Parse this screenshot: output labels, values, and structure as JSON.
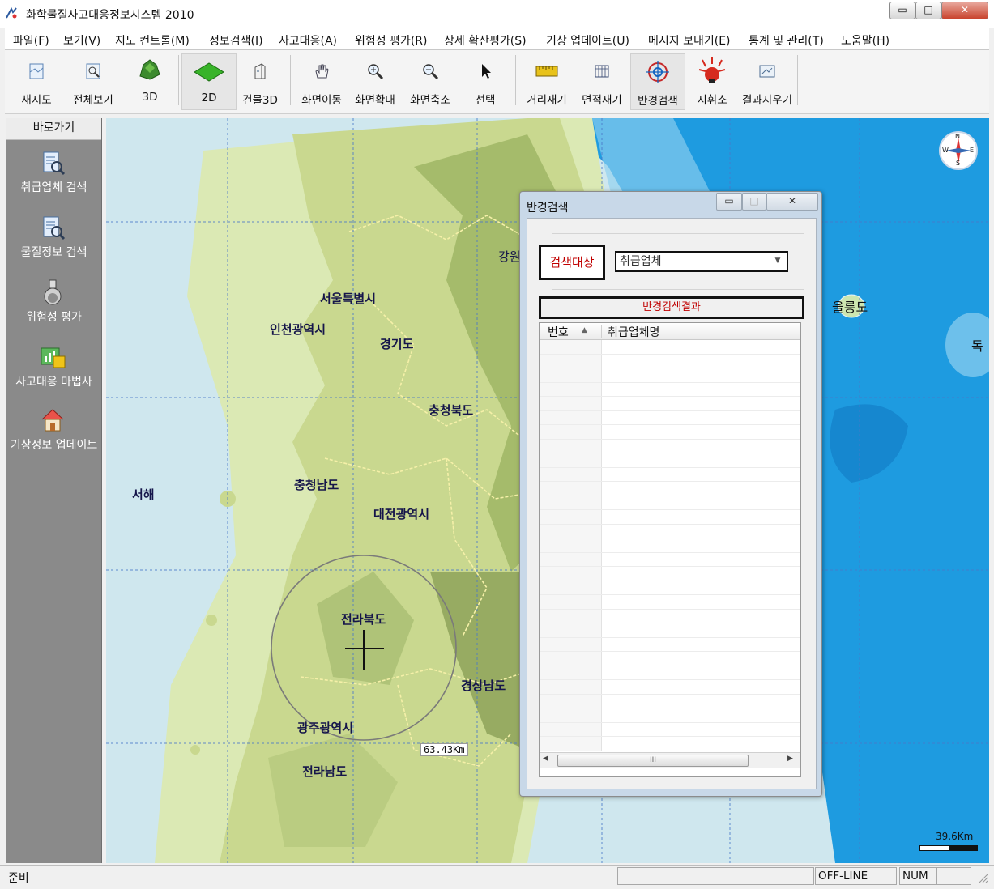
{
  "window": {
    "title": "화학물질사고대응정보시스템 2010",
    "controls": {
      "minimize": "▭",
      "maximize": "□",
      "close": "✕"
    }
  },
  "menu": [
    "파일(F)",
    "보기(V)",
    "지도 컨트롤(M)",
    "정보검색(I)",
    "사고대응(A)",
    "위험성 평가(R)",
    "상세 확산평가(S)",
    "기상 업데이트(U)",
    "메시지 보내기(E)",
    "통계 및 관리(T)",
    "도움말(H)"
  ],
  "toolbar": [
    {
      "label": "새지도",
      "icon": "new-map-icon"
    },
    {
      "label": "전체보기",
      "icon": "full-view-icon"
    },
    {
      "label": "3D",
      "icon": "3d-terrain-icon"
    },
    {
      "label": "2D",
      "icon": "2d-map-icon",
      "active": true
    },
    {
      "label": "건물3D",
      "icon": "building-3d-icon"
    },
    {
      "label": "화면이동",
      "icon": "pan-hand-icon"
    },
    {
      "label": "화면확대",
      "icon": "zoom-in-icon"
    },
    {
      "label": "화면축소",
      "icon": "zoom-out-icon"
    },
    {
      "label": "선택",
      "icon": "select-arrow-icon"
    },
    {
      "label": "거리재기",
      "icon": "ruler-icon"
    },
    {
      "label": "면적재기",
      "icon": "area-measure-icon"
    },
    {
      "label": "반경검색",
      "icon": "radius-target-icon",
      "active": true
    },
    {
      "label": "지휘소",
      "icon": "command-post-icon"
    },
    {
      "label": "결과지우기",
      "icon": "clear-result-icon"
    }
  ],
  "shortcut_panel": {
    "title": "바로가기",
    "items": [
      {
        "label": "취급업체 검색",
        "icon": "facility-search-icon"
      },
      {
        "label": "물질정보 검색",
        "icon": "material-search-icon"
      },
      {
        "label": "위험성 평가",
        "icon": "flask-icon"
      },
      {
        "label": "사고대응 마법사",
        "icon": "chart-wizard-icon"
      },
      {
        "label": "기상정보 업데이트",
        "icon": "weather-house-icon"
      }
    ]
  },
  "map": {
    "labels": [
      "서울특별시",
      "인천광역시",
      "경기도",
      "충청북도",
      "충청남도",
      "대전광역시",
      "전라북도",
      "경상남도",
      "광주광역시",
      "전라남도",
      "서해",
      "울릉도",
      "강원",
      "독"
    ],
    "radius_text": "63.43Km",
    "scale_text": "39.6Km",
    "compass": {
      "n": "N",
      "s": "S",
      "e": "E",
      "w": "W"
    },
    "colors": {
      "sea": "#cfe7ee",
      "deep_sea": "#1e9be0",
      "land": "#c9d88f",
      "land_dark": "#8ea35a"
    }
  },
  "dialog": {
    "title": "반경검색",
    "search_target_label": "검색대상",
    "search_target_value": "취급업체",
    "result_header": "반경검색결과",
    "columns": [
      "번호",
      "취급업체명"
    ],
    "scroll_grip": "III"
  },
  "status": {
    "ready": "준비",
    "mode": "OFF-LINE",
    "num": "NUM"
  }
}
